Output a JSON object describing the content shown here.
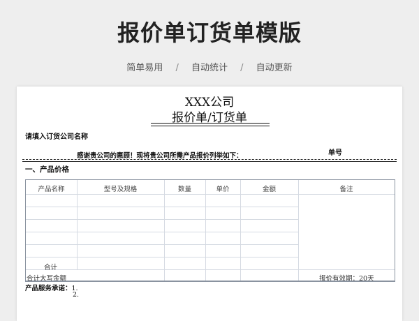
{
  "banner": {
    "title": "报价单订货单模版",
    "tags": [
      "简单易用",
      "自动统计",
      "自动更新"
    ],
    "separator": "/"
  },
  "sheet": {
    "company": "XXX公司",
    "title": "报价单/订货单",
    "fill_label": "请填入订货公司名称",
    "thanks": "感谢贵公司的惠顾！现将贵公司所需产品报价列举如下：",
    "order_no_label": "单号",
    "section1": "一、产品价格",
    "table": {
      "headers": [
        "产品名称",
        "型号及规格",
        "数量",
        "单价",
        "金额",
        "备注"
      ]
    },
    "total_label": "合计",
    "caps_total_label": "合计大写金额",
    "validity": "报价有效期：20天",
    "promise_label": "产品服务承诺：",
    "promise_items": [
      "1.",
      "2."
    ]
  }
}
